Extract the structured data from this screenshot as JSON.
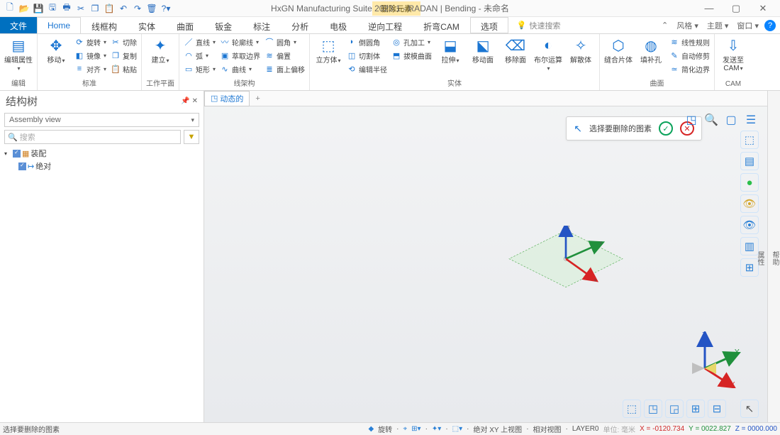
{
  "title": "HxGN Manufacturing Suite 2023.1 - RADAN | Bending - 未命名",
  "highlight_tab": "删除元素",
  "qat_icons": [
    "新建",
    "打开",
    "保存",
    "另存",
    "打印",
    "剪切",
    "复制",
    "粘贴",
    "撤销",
    "重做",
    "删除",
    "帮助"
  ],
  "win": {
    "min": "—",
    "max": "▢",
    "close": "✕"
  },
  "tabs": {
    "file": "文件",
    "home": "Home",
    "items": [
      "线框构",
      "实体",
      "曲面",
      "钣金",
      "标注",
      "分析",
      "电极",
      "逆向工程",
      "折弯CAM"
    ],
    "options": "选项",
    "search_placeholder": "快速搜索"
  },
  "right_tabs": {
    "style": "风格 ▾",
    "theme": "主题 ▾",
    "window": "窗口 ▾"
  },
  "ribbon": {
    "g_edit": {
      "label": "编辑",
      "big": "编辑属性"
    },
    "g_std": {
      "label": "标准",
      "move": "移动",
      "rotate": "旋转",
      "mirror": "镜像",
      "align": "对齐",
      "cut": "切除",
      "copy": "复制",
      "paste": "粘贴"
    },
    "g_wp": {
      "label": "工作平面",
      "build": "建立"
    },
    "g_wf": {
      "label": "线架构",
      "line": "直线",
      "arc": "弧",
      "rect": "矩形",
      "profile": "轮廓线",
      "extract": "萃取边界",
      "curve": "曲线",
      "fillet": "圆角",
      "offset": "偏置",
      "edgeoffset": "面上偏移"
    },
    "g_solid": {
      "label": "实体",
      "cube": "立方体",
      "radius": "编辑半径",
      "fillet": "倒圆角",
      "cutbody": "切割体",
      "sweepface": "拔模曲面",
      "hole": "孔加工",
      "extrude": "拉伸",
      "movef": "移动面",
      "removef": "移除面",
      "bool": "布尔运算",
      "explode": "解散体"
    },
    "g_surf": {
      "label": "曲面",
      "combine": "缝合片体",
      "fillhole": "填补孔",
      "ruled": "线性规则",
      "autorep": "自动修剪",
      "simplify": "简化边界"
    },
    "g_cam": {
      "label": "CAM",
      "send": "发送至CAM"
    }
  },
  "structure_tree": {
    "title": "结构树",
    "assembly": "Assembly view",
    "search_ph": "搜索",
    "root": "装配",
    "child": "绝对"
  },
  "viewport": {
    "tab": "动态的",
    "prompt": "选择要删除的图素"
  },
  "sidebar": {
    "help": "帮助",
    "prop": "属性"
  },
  "statusbar": {
    "left": "选择要删除的图素",
    "rotate": "旋转",
    "abs_view": "绝对 XY 上视图",
    "rel_view": "相对视图",
    "layer": "LAYER0",
    "unit": "单位: 毫米",
    "x": "X = -0120.734",
    "y": "Y = 0022.827",
    "z": "Z = 0000.000"
  },
  "axes": {
    "x": "x",
    "y": "y",
    "z": "z",
    "X": "X",
    "Y": "Y",
    "Z": "Z"
  }
}
